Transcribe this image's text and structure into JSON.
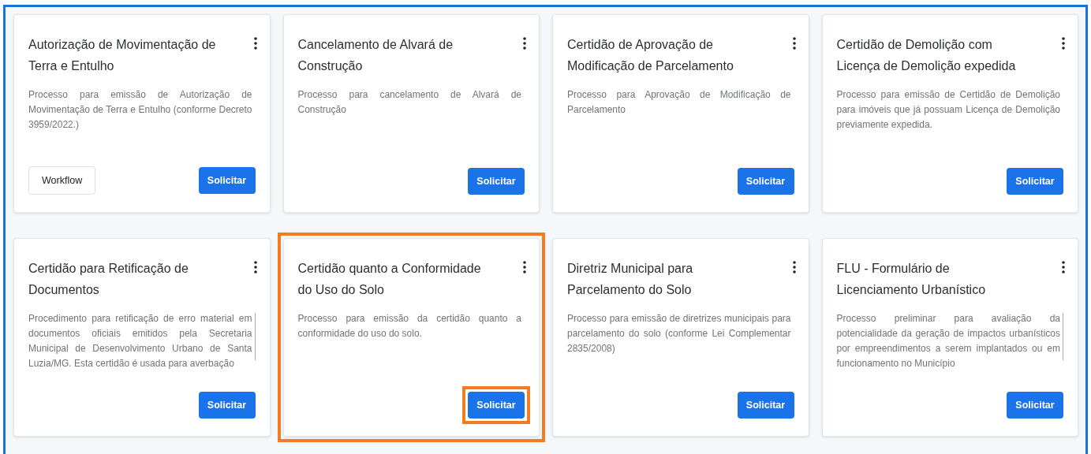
{
  "cards": [
    {
      "title": "Autorização de Movimentação de Terra e Entulho",
      "description": "Processo para emissão de Autorização de Movimentação de Terra e Entulho (conforme Decreto 3959/2022.)",
      "secondary_button": "Workflow",
      "button": "Solicitar",
      "highlighted": false,
      "button_highlighted": false,
      "scrollable": false
    },
    {
      "title": "Cancelamento de Alvará de Construção",
      "description": "Processo para cancelamento de Alvará de Construção",
      "button": "Solicitar",
      "highlighted": false,
      "button_highlighted": false,
      "scrollable": false
    },
    {
      "title": "Certidão de Aprovação de Modificação de Parcelamento",
      "description": "Processo para Aprovação de Modificação de Parcelamento",
      "button": "Solicitar",
      "highlighted": false,
      "button_highlighted": false,
      "scrollable": false
    },
    {
      "title": "Certidão de Demolição com Licença de Demolição expedida",
      "description": "Processo para emissão de Certidão de Demolição para imóveis que já possuam Licença de Demolição previamente expedida.",
      "button": "Solicitar",
      "highlighted": false,
      "button_highlighted": false,
      "scrollable": false
    },
    {
      "title": "Certidão para Retificação de Documentos",
      "description": "Procedimento para retificação de erro material em documentos oficiais emitidos pela Secretaria Municipal de Desenvolvimento Urbano de Santa Luzia/MG. Esta certidão é usada para averbação",
      "button": "Solicitar",
      "highlighted": false,
      "button_highlighted": false,
      "scrollable": true
    },
    {
      "title": "Certidão quanto a Conformidade do Uso do Solo",
      "description": "Processo para emissão da certidão quanto a conformidade do uso do solo.",
      "button": "Solicitar",
      "highlighted": true,
      "button_highlighted": true,
      "scrollable": false
    },
    {
      "title": "Diretriz Municipal para Parcelamento do Solo",
      "description": "Processo para emissão de diretrizes municipais para parcelamento do solo (conforme Lei Complementar 2835/2008)",
      "button": "Solicitar",
      "highlighted": false,
      "button_highlighted": false,
      "scrollable": false
    },
    {
      "title": "FLU - Formulário de Licenciamento Urbanístico",
      "description": "Processo preliminar para avaliação da potencialidade da geração de impactos urbanísticos por empreendimentos a serem implantados ou em funcionamento no Município",
      "button": "Solicitar",
      "highlighted": false,
      "button_highlighted": false,
      "scrollable": true
    }
  ]
}
